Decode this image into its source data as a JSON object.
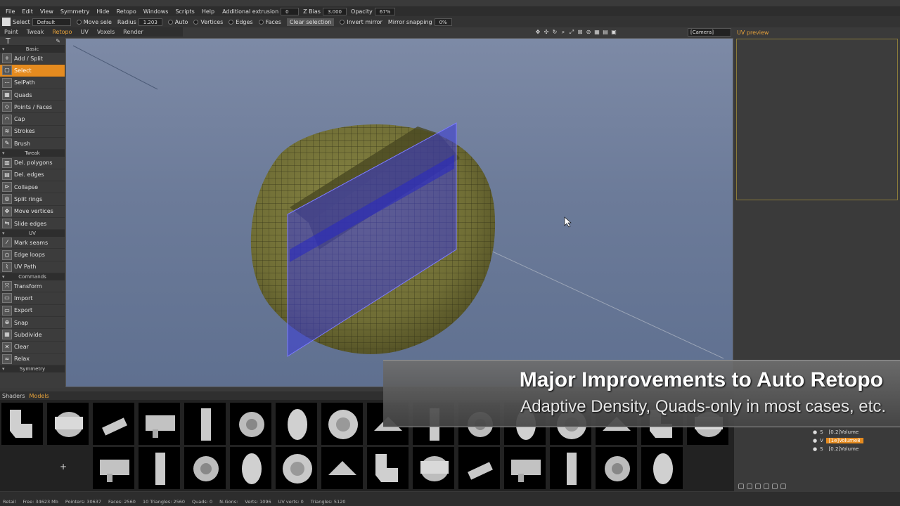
{
  "menubar": {
    "items": [
      "File",
      "Edit",
      "View",
      "Symmetry",
      "Hide",
      "Retopo",
      "Windows",
      "Scripts",
      "Help"
    ],
    "fields": [
      {
        "label": "Additional extrusion",
        "value": "0"
      },
      {
        "label": "Z Bias",
        "value": "3.000"
      },
      {
        "label": "Opacity",
        "value": "67%"
      }
    ]
  },
  "toolbar": {
    "select_label": "Select",
    "select_value": "Default",
    "move_label": "Move sele",
    "radius_label": "Radius",
    "radius_value": "1.203",
    "auto_label": "Auto",
    "vertices_label": "Vertices",
    "edges_label": "Edges",
    "faces_label": "Faces",
    "clear_selection_label": "Clear selection",
    "invert_mirror_label": "Invert mirror",
    "mirror_snapping_label": "Mirror snapping",
    "mirror_snapping_value": "0%"
  },
  "rooms": {
    "tabs": [
      {
        "label": "Paint",
        "active": false
      },
      {
        "label": "Tweak",
        "active": false
      },
      {
        "label": "Retopo",
        "active": true
      },
      {
        "label": "UV",
        "active": false
      },
      {
        "label": "Voxels",
        "active": false
      },
      {
        "label": "Render",
        "active": false
      }
    ]
  },
  "camera": {
    "value": "[Camera]"
  },
  "left_panel": {
    "head": "T",
    "sections": [
      {
        "title": "Basic",
        "tools": [
          {
            "label": "Add / Split",
            "active": false
          },
          {
            "label": "Select",
            "active": true
          },
          {
            "label": "SelPath",
            "active": false
          },
          {
            "label": "Quads",
            "active": false
          },
          {
            "label": "Points / Faces",
            "active": false
          },
          {
            "label": "Cap",
            "active": false
          },
          {
            "label": "Strokes",
            "active": false
          },
          {
            "label": "Brush",
            "active": false
          }
        ]
      },
      {
        "title": "Tweak",
        "tools": [
          {
            "label": "Del. polygons",
            "active": false
          },
          {
            "label": "Del. edges",
            "active": false
          },
          {
            "label": "Collapse",
            "active": false
          },
          {
            "label": "Split rings",
            "active": false
          },
          {
            "label": "Move vertices",
            "active": false
          },
          {
            "label": "Slide edges",
            "active": false
          }
        ]
      },
      {
        "title": "UV",
        "tools": [
          {
            "label": "Mark seams",
            "active": false
          },
          {
            "label": "Edge loops",
            "active": false
          },
          {
            "label": "UV Path",
            "active": false
          }
        ]
      },
      {
        "title": "Commands",
        "tools": [
          {
            "label": "Transform",
            "active": false
          },
          {
            "label": "Import",
            "active": false
          },
          {
            "label": "Export",
            "active": false
          },
          {
            "label": "Snap",
            "active": false
          },
          {
            "label": "Subdivide",
            "active": false
          },
          {
            "label": "Clear",
            "active": false
          },
          {
            "label": "Relax",
            "active": false
          }
        ]
      }
    ],
    "last_section": "Symmetry"
  },
  "uv_preview": {
    "title": "UV preview"
  },
  "layers": [
    {
      "prefix": "S",
      "name": "[0.2]Volume",
      "active": false
    },
    {
      "prefix": "V",
      "name": "[1e]Volume8",
      "active": true
    },
    {
      "prefix": "S",
      "name": "[0.2]Volume",
      "active": false
    }
  ],
  "shelf": {
    "tabs": [
      {
        "label": "Shaders",
        "active": false
      },
      {
        "label": "Models",
        "active": true
      }
    ],
    "add_label": "+"
  },
  "status": {
    "items": [
      "Retail",
      "Free: 34623 Mb",
      "Pointers: 30637",
      "Faces: 2560",
      "10 Triangles: 2560",
      "Quads: 0",
      "N-Gons:",
      "Verts: 1096",
      "UV verts: 0",
      "Triangles: 5120"
    ]
  },
  "banner": {
    "title": "Major Improvements to Auto Retopo",
    "subtitle": "Adaptive Density, Quads-only in most cases, etc."
  },
  "colors": {
    "accent": "#e58b1f",
    "mesh": "#7c7a3c",
    "plane": "#3a3ad8"
  }
}
